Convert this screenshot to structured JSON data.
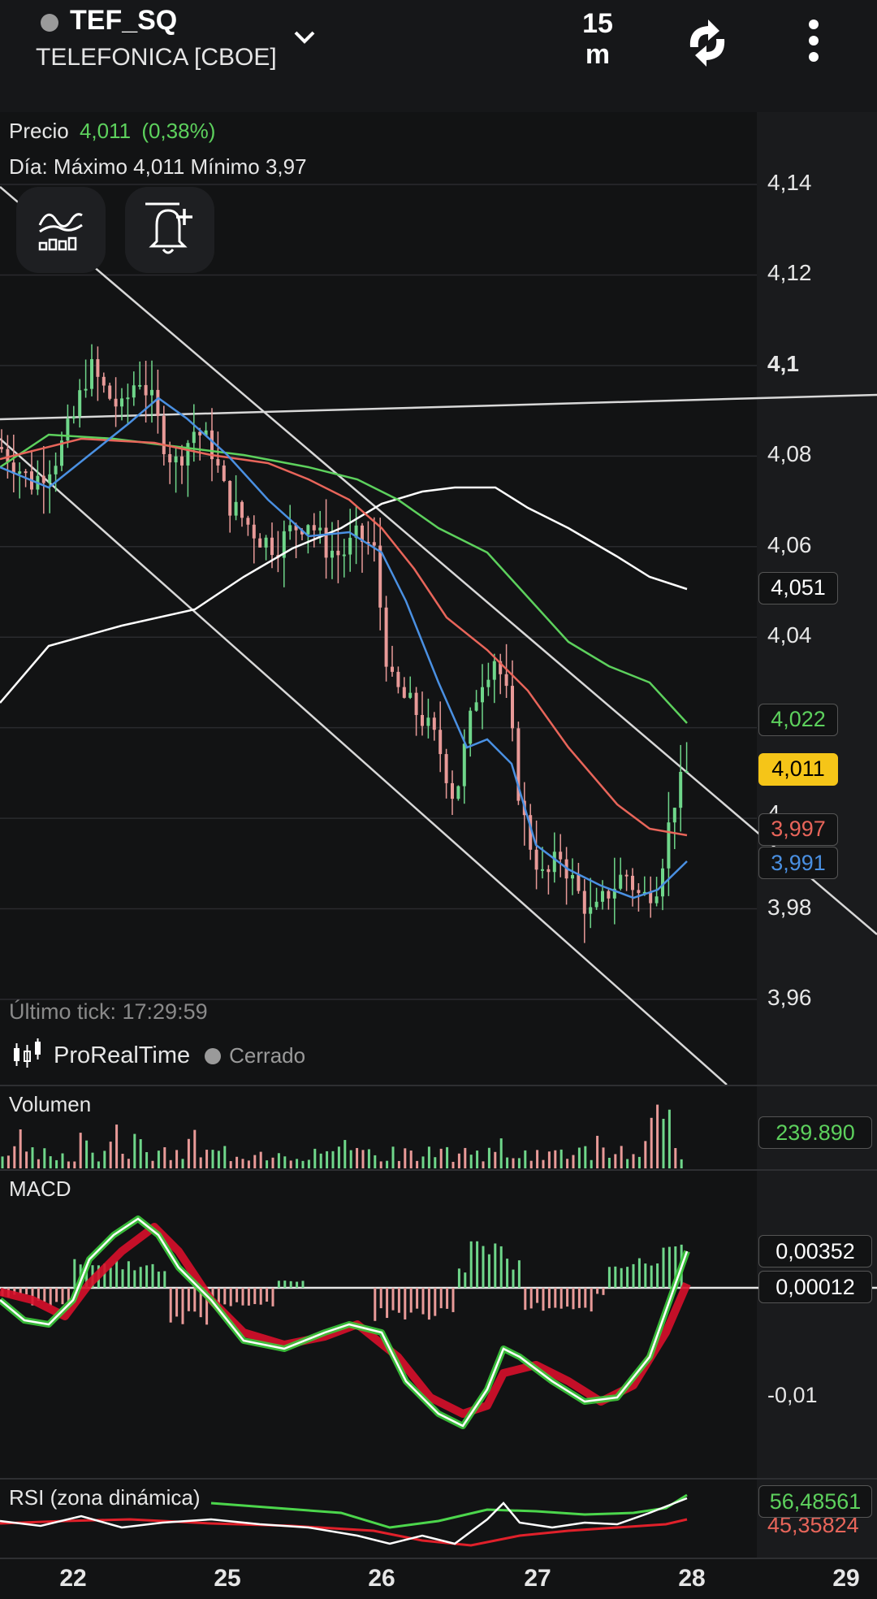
{
  "header": {
    "symbol": "TEF_SQ",
    "exchange": "TELEFONICA [CBOE]",
    "interval": "15\nm",
    "interval_num": "15",
    "interval_unit": "m"
  },
  "info": {
    "price_label": "Precio",
    "price_value": "4,011",
    "price_change": "(0,38%)",
    "day_range": "Día: Máximo 4,011 Mínimo 3,97",
    "last_tick": "Último tick: 17:29:59",
    "provider": "ProRealTime",
    "market_status": "Cerrado"
  },
  "price_axis": {
    "ticks": [
      "4,14",
      "4,12",
      "4,1",
      "4,08",
      "4,06",
      "4,04",
      "3,98",
      "3,96"
    ],
    "tags": [
      {
        "value": "4,051",
        "color": "#ffffff"
      },
      {
        "value": "4,022",
        "color": "#5dd15d"
      },
      {
        "value": "4,011",
        "color": "#000000",
        "bg": "#f5c518"
      },
      {
        "value": "3,997",
        "color": "#e8655a"
      },
      {
        "value": "3,991",
        "color": "#4a90e2"
      }
    ]
  },
  "volume": {
    "label": "Volumen",
    "value": "239.890"
  },
  "macd": {
    "label": "MACD",
    "tags": [
      "0,00352",
      "0,00012"
    ],
    "tick": "-0,01"
  },
  "rsi": {
    "label": "RSI (zona dinámica)",
    "value": "56,48561",
    "hidden_value": "45,35824"
  },
  "x_axis": {
    "labels": [
      "22",
      "25",
      "26",
      "27",
      "28",
      "29"
    ]
  },
  "colors": {
    "bull": "#6fd68a",
    "bear": "#e89a98",
    "sma_fast": "#4a90e2",
    "sma_mid": "#e8655a",
    "sma_slow": "#5dd15d",
    "sma_long": "#ffffff",
    "macd_up": "#3ccb3c",
    "macd_down": "#d8102a"
  },
  "icons": [
    "indicators-icon",
    "alert-add-icon",
    "refresh-icon",
    "more-vert-icon",
    "chevron-down-icon",
    "candlestick-icon"
  ]
}
